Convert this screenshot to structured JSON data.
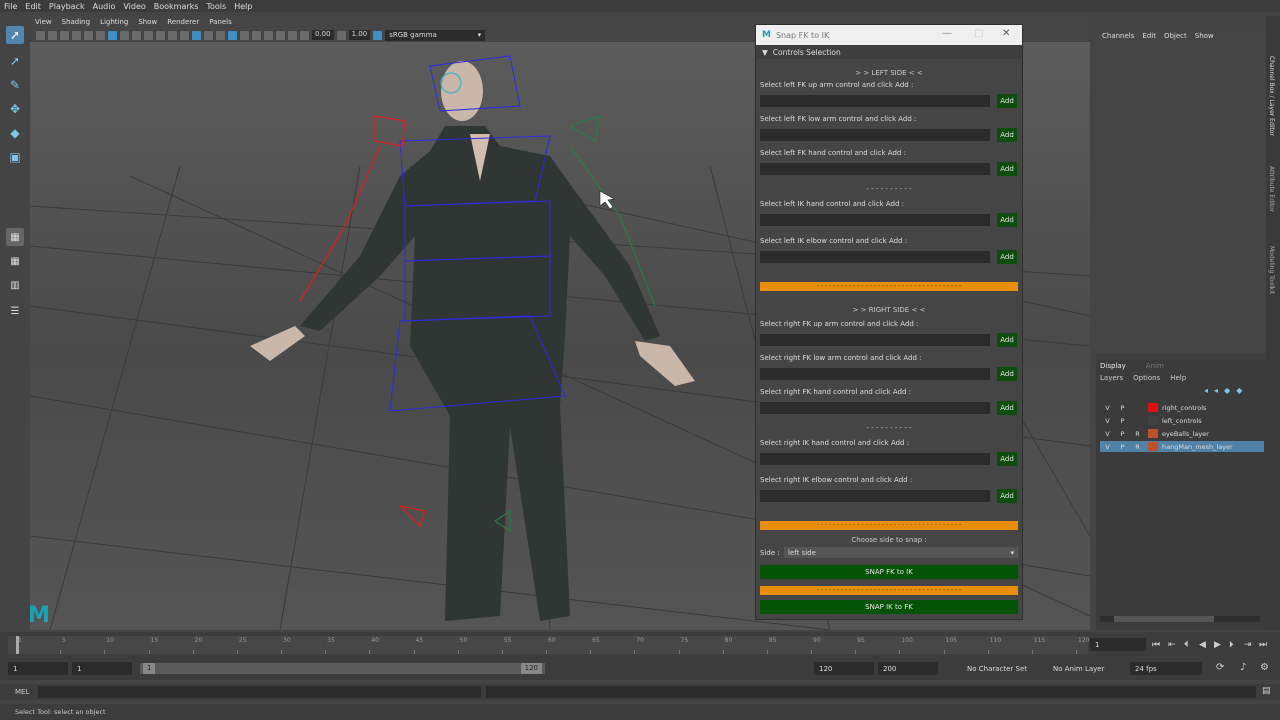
{
  "menubar": [
    "File",
    "Edit",
    "Playback",
    "Audio",
    "Video",
    "Bookmarks",
    "Tools",
    "Help"
  ],
  "viewport": {
    "menu": [
      "View",
      "Shading",
      "Lighting",
      "Show",
      "Renderer",
      "Panels"
    ],
    "exposure": "0.00",
    "gamma_value": "1.00",
    "color_space": "sRGB gamma"
  },
  "snap_window": {
    "title": "Snap FK to IK",
    "section": "Controls Selection",
    "left_side_header": "> > LEFT SIDE < <",
    "right_side_header": "> > RIGHT SIDE < <",
    "separator": "- - - - - - - - - -",
    "orange_text": "- - - - - - - - - - - - - - - - - - - - - - - - - - - - - - - - - - - -",
    "left_labels": [
      "Select left FK up arm control and click Add :",
      "Select left FK low arm control and click Add :",
      "Select left FK hand control and click Add :",
      "Select left IK hand control and click Add :",
      "Select left IK elbow control and click Add :"
    ],
    "right_labels": [
      "Select right FK up arm control and click Add :",
      "Select right FK low arm control and click Add :",
      "Select right FK hand control and click Add :",
      "Select right IK hand control and click Add :",
      "Select right IK elbow control and click Add :"
    ],
    "add_label": "Add",
    "choose_side": "Choose side to snap :",
    "side_label": "Side :",
    "side_value": "left side",
    "snap_fk_to_ik": "SNAP FK to IK",
    "snap_ik_to_fk": "SNAP IK to FK"
  },
  "channel_box": {
    "menu": [
      "Channels",
      "Edit",
      "Object",
      "Show"
    ]
  },
  "layer_editor": {
    "tabs": [
      "Display",
      "Anim"
    ],
    "menu": [
      "Layers",
      "Options",
      "Help"
    ],
    "layers": [
      {
        "v": "V",
        "p": "P",
        "r": "",
        "color": "#e01010",
        "name": "right_controls",
        "selected": false
      },
      {
        "v": "V",
        "p": "P",
        "r": "",
        "color": "#404040",
        "name": "left_controls",
        "selected": false
      },
      {
        "v": "V",
        "p": "P",
        "r": "R",
        "color": "#c0502a",
        "name": "eyeBalls_layer",
        "selected": false
      },
      {
        "v": "V",
        "p": "P",
        "r": "R",
        "color": "#c0502a",
        "name": "hangMan_mesh_layer",
        "selected": true
      }
    ]
  },
  "side_tabs": [
    "Channel Box / Layer Editor",
    "Attribute Editor",
    "Modeling Toolkit"
  ],
  "timeline": {
    "ticks": [
      "1",
      "5",
      "10",
      "15",
      "20",
      "25",
      "30",
      "35",
      "40",
      "45",
      "50",
      "55",
      "60",
      "65",
      "70",
      "75",
      "80",
      "85",
      "90",
      "95",
      "100",
      "105",
      "110",
      "115",
      "120"
    ],
    "current_frame": "1"
  },
  "range": {
    "start": "1",
    "anim_start": "1",
    "range_start": "1",
    "range_end": "120",
    "end": "120",
    "anim_end": "200",
    "character_set": "No Character Set",
    "anim_layer": "No Anim Layer",
    "fps": "24 fps"
  },
  "mel_label": "MEL",
  "help_line": "Select Tool: select an object"
}
